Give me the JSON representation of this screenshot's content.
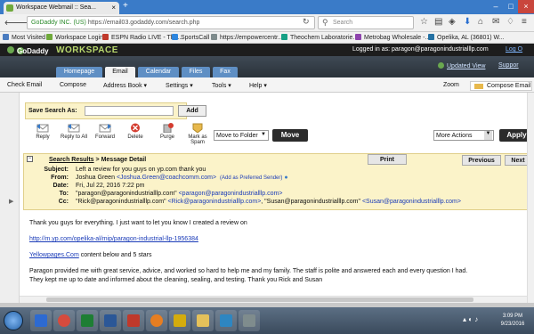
{
  "browser": {
    "tab_title": "Workspace Webmail :: Sea...",
    "url_site": "GoDaddy INC. (US)",
    "url_path": "https://email03.godaddy.com/search.php",
    "search_placeholder": "Search",
    "bookmarks": [
      {
        "label": "Most Visited",
        "color": "#4a7cc0"
      },
      {
        "label": "Workspace Login",
        "color": "#6fa93b"
      },
      {
        "label": "ESPN Radio LIVE - The...",
        "color": "#c0392b"
      },
      {
        "label": "SportsCall",
        "color": "#2e86de"
      },
      {
        "label": "https://empowercentr...",
        "color": "#7f8c8d"
      },
      {
        "label": "Theochem Laboratorie...",
        "color": "#16a085"
      },
      {
        "label": "Metrobag Wholesale -...",
        "color": "#8e44ad"
      },
      {
        "label": "Opelika, AL (36801) W...",
        "color": "#2471a3"
      }
    ]
  },
  "app": {
    "logo": "GoDaddy",
    "product": "WORKSPACE",
    "logged_in": "Logged in as: paragon@paragonindustrialllp.com",
    "logout": "Log O",
    "tabs": [
      {
        "label": "Homepage",
        "active": false
      },
      {
        "label": "Email",
        "active": true
      },
      {
        "label": "Calendar",
        "active": false
      },
      {
        "label": "Files",
        "active": false
      },
      {
        "label": "Fax",
        "active": false
      }
    ],
    "updated_view": "Updated View",
    "support": "Suppor"
  },
  "menu": {
    "items": [
      "Check Email",
      "Compose",
      "Address Book ▾",
      "Settings ▾",
      "Tools ▾",
      "Help ▾"
    ],
    "zoom": "Zoom",
    "compose_message": "Compose Email"
  },
  "save_search": {
    "label": "Save Search As:",
    "value": "",
    "add": "Add"
  },
  "toolbar": {
    "reply": "Reply",
    "reply_all": "Reply to All",
    "forward": "Forward",
    "delete": "Delete",
    "purge": "Purge",
    "mark_spam": "Mark as Spam",
    "move_to_folder": "Move to Folder",
    "move": "Move",
    "more_actions": "More Actions",
    "apply": "Apply"
  },
  "message": {
    "breadcrumb_link": "Search Results",
    "breadcrumb_rest": " > Message Detail",
    "print": "Print",
    "previous": "Previous",
    "next": "Next",
    "subject_label": "Subject:",
    "subject": "Left a review for you guys on yp.com thank you",
    "from_label": "From:",
    "from_name": "Joshua Green",
    "from_email": "<Joshua.Green@coachcomm.com>",
    "add_preferred": "(Add as Preferred Sender)",
    "date_label": "Date:",
    "date": "Fri, Jul 22, 2016 7:22 pm",
    "to_label": "To:",
    "to": "\"paragon@paragonindustrialllp.com\"",
    "to_email": "<paragon@paragonindustrialllp.com>",
    "cc_label": "Cc:",
    "cc_1": "\"Rick@paragonindustrialllp.com\"",
    "cc_1_email": "<Rick@paragonindustrialllp.com>",
    "cc_2": ", \"Susan@paragonindustrialllp.com\"",
    "cc_2_email": "<Susan@paragonindustrialllp.com>",
    "body": [
      "Thank you guys for everything. I just want to let you know I created a review on",
      "http://m.yp.com/opelika-al/mip/paragon-industrial-llp-1956384",
      "Yellowpages.Com",
      " content below and 5 stars",
      "Paragon provided me with great service, advice, and worked so hard to help me and my family. The staff is polite and answered each and every question I had.",
      "They kept me up to date and informed about the cleaning, sealing, and testing. Thank you Rick and Susan"
    ]
  },
  "taskbar": {
    "time": "3:09 PM",
    "date": "9/23/2016",
    "apps": [
      {
        "name": "media",
        "color": "#2d6ad1"
      },
      {
        "name": "chrome",
        "color": "#d64b3d"
      },
      {
        "name": "excel",
        "color": "#1e7e34"
      },
      {
        "name": "word",
        "color": "#2b5797"
      },
      {
        "name": "acrobat",
        "color": "#c0392b"
      },
      {
        "name": "firefox",
        "color": "#e67e22"
      },
      {
        "name": "paint",
        "color": "#d4ac0d"
      },
      {
        "name": "explorer",
        "color": "#e5c15a"
      },
      {
        "name": "outlook",
        "color": "#2e86c1"
      },
      {
        "name": "calculator",
        "color": "#7f8c8d"
      }
    ]
  }
}
